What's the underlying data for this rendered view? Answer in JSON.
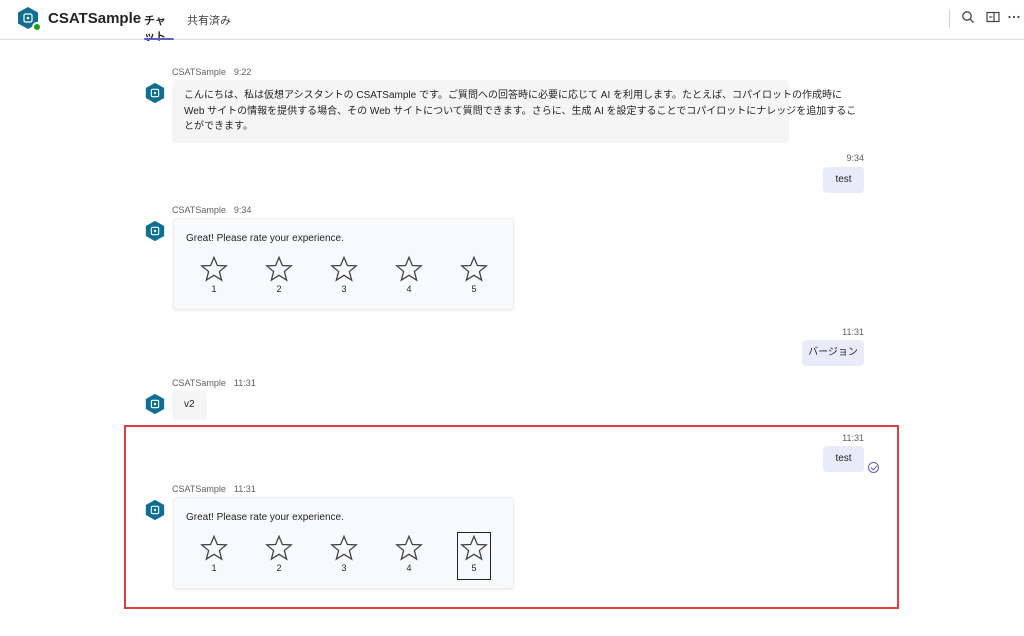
{
  "app": {
    "title": "CSATSample",
    "icon": "bot-avatar-icon",
    "status": "online",
    "accent_color": "#5b5fc7"
  },
  "tabs": [
    {
      "label": "チャット",
      "active": true
    },
    {
      "label": "共有済み",
      "active": false
    }
  ],
  "header_icons": [
    "search-icon",
    "panel-toggle-icon",
    "more-options-icon"
  ],
  "messages": [
    {
      "type": "bot",
      "sender": "CSATSample",
      "time": "9:22",
      "lines": [
        "こんにちは、私は仮想アシスタントの CSATSample です。ご質問への回答時に必要に応じて AI を利用します。たとえば、コパイロットの作成時に",
        "Web サイトの情報を提供する場合、その Web サイトについて質問できます。さらに、生成 AI を設定することでコパイロットにナレッジを追加するこ",
        "とができます。"
      ]
    },
    {
      "type": "user",
      "time": "9:34",
      "text": "test"
    },
    {
      "type": "bot",
      "sender": "CSATSample",
      "time": "9:34",
      "card": {
        "prompt": "Great! Please rate your experience.",
        "ratings": [
          "1",
          "2",
          "3",
          "4",
          "5"
        ]
      }
    },
    {
      "type": "user",
      "time": "11:31",
      "text": "バージョン"
    },
    {
      "type": "bot",
      "sender": "CSATSample",
      "time": "11:31",
      "text": "v2"
    },
    {
      "type": "user",
      "time": "11:31",
      "text": "test",
      "status_icon": "sent-check-icon"
    },
    {
      "type": "bot",
      "sender": "CSATSample",
      "time": "11:31",
      "card": {
        "prompt": "Great! Please rate your experience.",
        "ratings": [
          "1",
          "2",
          "3",
          "4",
          "5"
        ],
        "focused_rating": "5"
      }
    }
  ],
  "highlight_color": "#e03e3e"
}
